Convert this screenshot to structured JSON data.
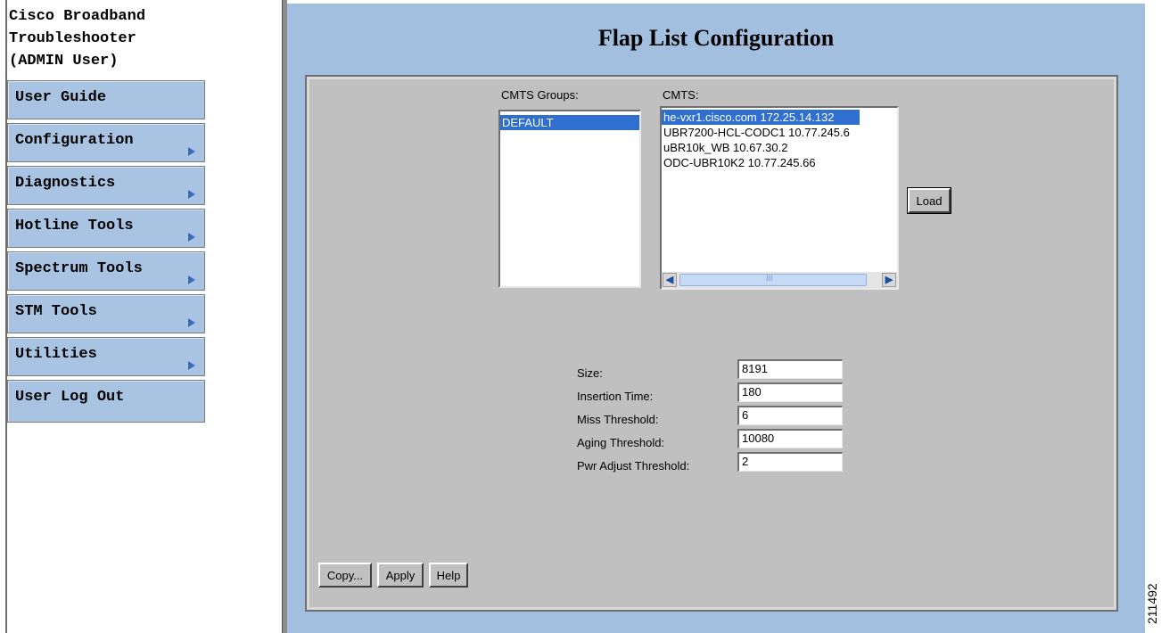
{
  "app": {
    "title": "Cisco Broadband\nTroubleshooter\n(ADMIN User)"
  },
  "menu": [
    {
      "label": "User Guide",
      "has_submenu": false
    },
    {
      "label": "Configuration",
      "has_submenu": true
    },
    {
      "label": "Diagnostics",
      "has_submenu": true
    },
    {
      "label": "Hotline Tools",
      "has_submenu": true
    },
    {
      "label": "Spectrum Tools",
      "has_submenu": true
    },
    {
      "label": "STM Tools",
      "has_submenu": true
    },
    {
      "label": "Utilities",
      "has_submenu": true
    },
    {
      "label": "User Log Out",
      "has_submenu": false
    }
  ],
  "page": {
    "title": "Flap List Configuration"
  },
  "cmts_groups": {
    "label": "CMTS Groups:",
    "items": [
      "DEFAULT"
    ],
    "selected": "DEFAULT"
  },
  "cmts": {
    "label": "CMTS:",
    "items": [
      "he-vxr1.cisco.com 172.25.14.132",
      "UBR7200-HCL-CODC1 10.77.245.6",
      "uBR10k_WB 10.67.30.2",
      "ODC-UBR10K2 10.77.245.66"
    ],
    "selected": "he-vxr1.cisco.com 172.25.14.132",
    "scroll_glyph": "III"
  },
  "load_button": "Load",
  "fields": [
    {
      "label": "Size:",
      "value": "8191"
    },
    {
      "label": "Insertion Time:",
      "value": "180"
    },
    {
      "label": "Miss Threshold:",
      "value": "6"
    },
    {
      "label": "Aging Threshold:",
      "value": "10080"
    },
    {
      "label": "Pwr Adjust Threshold:",
      "value": "2"
    }
  ],
  "buttons": {
    "copy": "Copy...",
    "apply": "Apply",
    "help": "Help"
  },
  "figure_id": "211492",
  "colors": {
    "menu_bg": "#a9c4e3",
    "main_bg": "#a3bfdf",
    "panel_bg": "#c0c0c0",
    "selection": "#2f6fcf",
    "arrow": "#3a6fbd"
  }
}
